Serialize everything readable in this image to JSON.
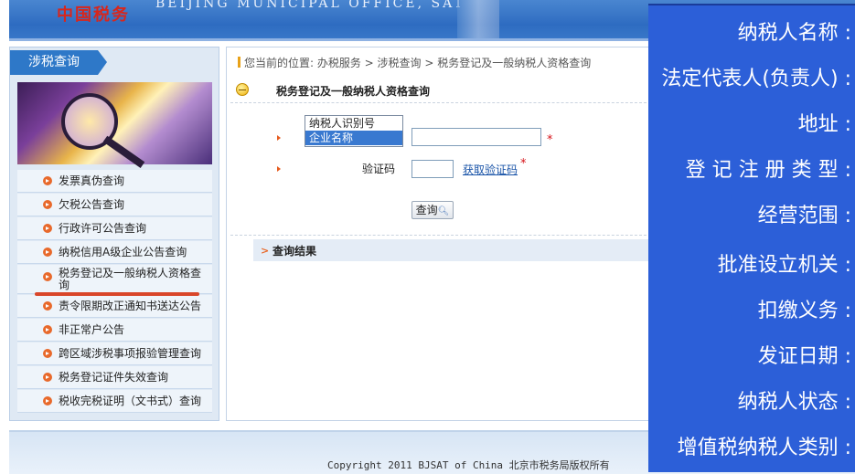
{
  "header": {
    "logo_text": "中国税务",
    "office_name": "BEIJING MUNICIPAL OFFICE, SAT"
  },
  "sidebar": {
    "tab_label": "涉税查询",
    "items": [
      {
        "label": "发票真伪查询"
      },
      {
        "label": "欠税公告查询"
      },
      {
        "label": "行政许可公告查询"
      },
      {
        "label": "纳税信用A级企业公告查询"
      },
      {
        "label": "税务登记及一般纳税人资格查询"
      },
      {
        "label": "责令限期改正通知书送达公告"
      },
      {
        "label": "非正常户公告"
      },
      {
        "label": "跨区域涉税事项报验管理查询"
      },
      {
        "label": "税务登记证件失效查询"
      },
      {
        "label": "税收完税证明（文书式）查询"
      }
    ]
  },
  "main": {
    "breadcrumb": "您当前的位置: 办税服务 > 涉税查询 > 税务登记及一般纳税人资格查询",
    "title": "税务登记及一般纳税人资格查询",
    "query_type_options": [
      "纳税人识别号",
      "企业名称"
    ],
    "query_type_selected": "企业名称",
    "name_value": "",
    "required_mark": "*",
    "captcha_label": "验证码",
    "captcha_value": "",
    "captcha_link": "获取验证码",
    "query_button": "查询",
    "result_title": "查询结果"
  },
  "footer": {
    "copyright": "Copyright 2011 BJSAT of China 北京市税务局版权所有"
  },
  "overlay": {
    "rows": [
      {
        "label": "纳税人名称 :"
      },
      {
        "label": "法定代表人(负责人) :"
      },
      {
        "label": "地址 :"
      },
      {
        "label": "登 记 注 册 类 型 :"
      },
      {
        "label": "经营范围 :"
      },
      {
        "label": "批准设立机关 :"
      },
      {
        "label": "扣缴义务 :"
      },
      {
        "label": "发证日期 :"
      },
      {
        "label": "纳税人状态 :"
      },
      {
        "label": "增值税纳税人类别 :"
      }
    ]
  },
  "colors": {
    "header_blue": "#2e6cc1",
    "tab_blue": "#2e78c8",
    "overlay_blue": "#2c5fd8",
    "bullet_orange": "#e8692b",
    "highlight_red": "#d9462a",
    "link_blue": "#1a54a8"
  },
  "icons": {
    "menu_bullet": "orange-arrow-bullet-icon",
    "title": "yellow-minus-circle-icon",
    "search": "magnifier-icon",
    "result": "orange-double-arrow-icon"
  }
}
